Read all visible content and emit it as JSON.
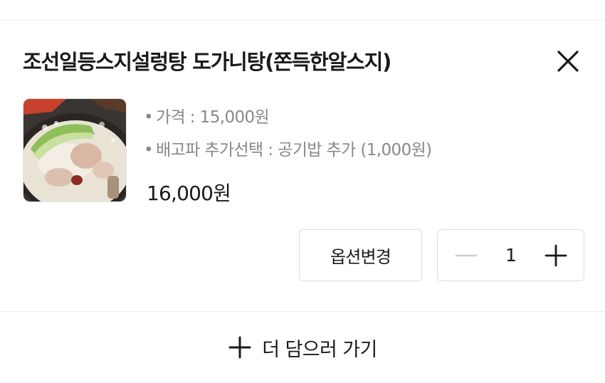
{
  "item": {
    "title": "조선일등스지설렁탕 도가니탕(쫀득한알스지)",
    "image_icon": "soup-photo",
    "options": [
      {
        "bullet": "•",
        "text": "가격 : 15,000원"
      },
      {
        "bullet": "•",
        "text": "배고파 추가선택 : 공기밥 추가 (1,000원)"
      }
    ],
    "price": "16,000원"
  },
  "actions": {
    "change_option_label": "옵션변경",
    "quantity": "1"
  },
  "footer": {
    "add_more_label": "더 담으러 가기"
  },
  "icons": {
    "close": "close-icon",
    "minus": "minus-icon",
    "plus": "plus-icon"
  },
  "colors": {
    "text": "#1a1a1a",
    "muted": "#888888",
    "border": "#dcdcdc",
    "disabled": "#cccccc"
  }
}
